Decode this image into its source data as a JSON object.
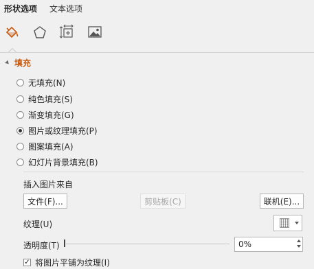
{
  "tabs": [
    {
      "label": "形状选项",
      "active": true
    },
    {
      "label": "文本选项",
      "active": false
    }
  ],
  "icons": [
    "fill-line-icon",
    "effects-pentagon-icon",
    "size-properties-icon",
    "picture-icon"
  ],
  "section": {
    "title": "填充",
    "options": [
      {
        "label": "无填充(N)",
        "checked": false
      },
      {
        "label": "纯色填充(S)",
        "checked": false
      },
      {
        "label": "渐变填充(G)",
        "checked": false
      },
      {
        "label": "图片或纹理填充(P)",
        "checked": true
      },
      {
        "label": "图案填充(A)",
        "checked": false
      },
      {
        "label": "幻灯片背景填充(B)",
        "checked": false
      }
    ]
  },
  "insert": {
    "label": "插入图片来自",
    "file_button": "文件(F)...",
    "clipboard_button": "剪贴板(C)",
    "online_button": "联机(E)..."
  },
  "texture": {
    "label": "纹理(U)"
  },
  "transparency": {
    "label": "透明度(T)",
    "value": "0%",
    "level": 0
  },
  "tile": {
    "label": "将图片平铺为纹理(I)",
    "checked": true
  },
  "colors": {
    "accent": "#c55a11",
    "background": "#f0f0f0"
  }
}
